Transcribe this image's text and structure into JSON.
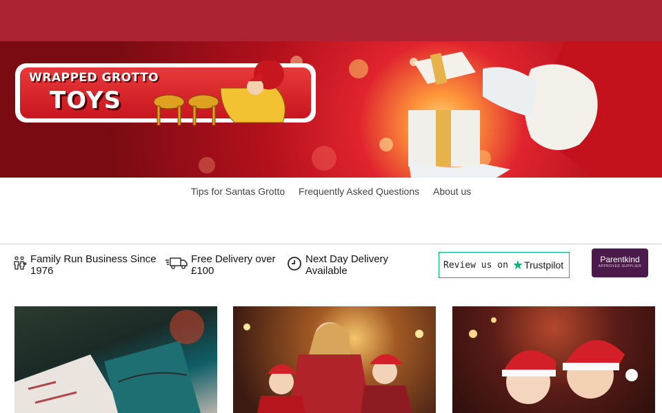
{
  "header": {
    "bar_color": "#ad2334"
  },
  "banner": {
    "logo_line1": "WRAPPED GROTTO",
    "logo_line2": "TOYS"
  },
  "nav": {
    "items": [
      {
        "label": "Tips for Santas Grotto"
      },
      {
        "label": "Frequently Asked Questions"
      },
      {
        "label": "About us"
      }
    ]
  },
  "usps": [
    {
      "icon": "family-icon",
      "text": "Family Run Business Since 1976"
    },
    {
      "icon": "delivery-truck-icon",
      "text": "Free Delivery over £100"
    },
    {
      "icon": "clock-icon",
      "text": "Next Day Delivery Available"
    }
  ],
  "trustpilot": {
    "prefix": "Review us on",
    "brand": "Trustpilot",
    "accent": "#00b67a"
  },
  "parentkind": {
    "name": "Parentkind",
    "sub": "APPROVED SUPPLIER",
    "bg": "#4b1a4a"
  },
  "cards": [
    {
      "icon": "wrapped-presents-image"
    },
    {
      "icon": "family-christmas-image"
    },
    {
      "icon": "children-santa-hats-image"
    }
  ]
}
